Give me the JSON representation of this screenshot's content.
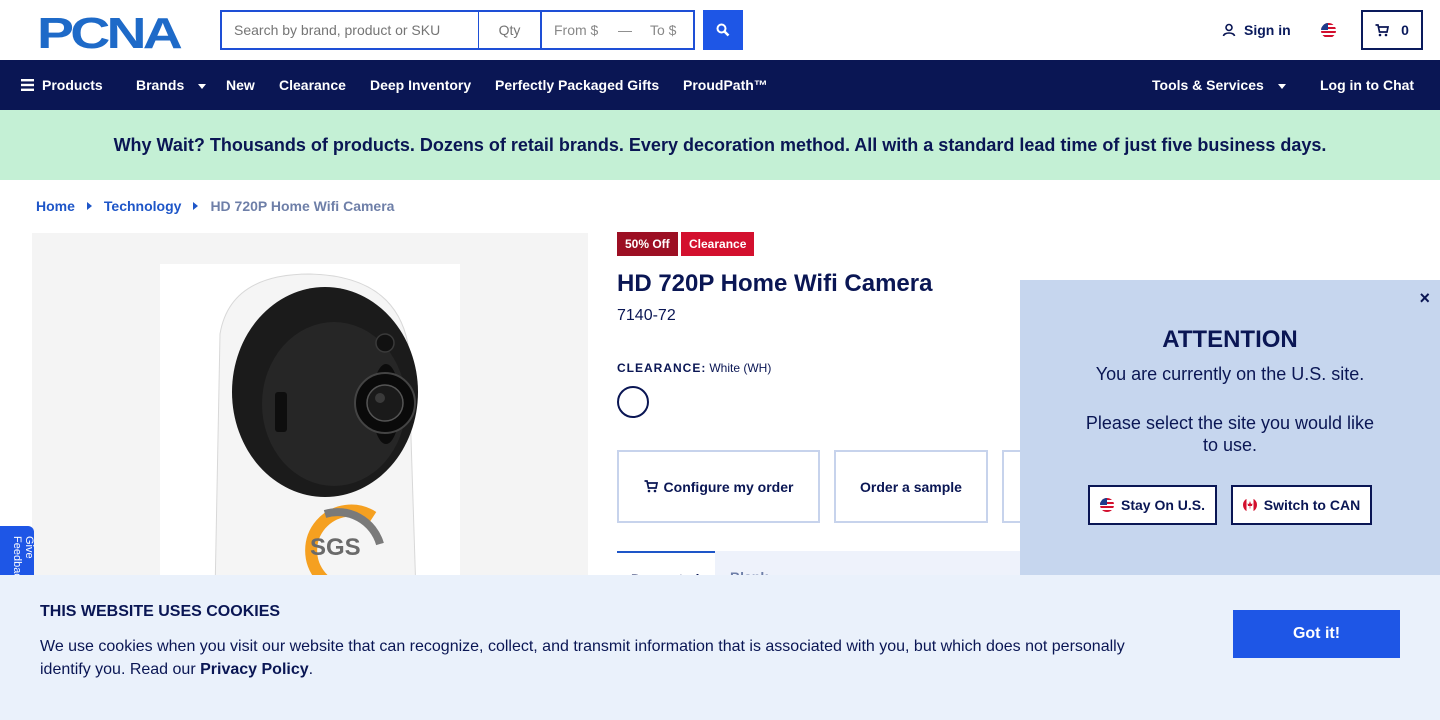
{
  "header": {
    "logo_text": "PCNA",
    "search_placeholder": "Search by brand, product or SKU",
    "qty_placeholder": "Qty",
    "price_from_placeholder": "From $",
    "price_to_placeholder": "To $",
    "sign_in_label": "Sign in",
    "cart_count": "0"
  },
  "nav": {
    "items": [
      "Products",
      "Brands",
      "New",
      "Clearance",
      "Deep Inventory",
      "Perfectly Packaged Gifts",
      "ProudPath™"
    ],
    "right_items": [
      "Tools & Services",
      "Log in to Chat"
    ]
  },
  "promo": {
    "text": "Why Wait? Thousands of products. Dozens of retail brands. Every decoration method. All with a standard lead time of just five business days."
  },
  "breadcrumb": [
    "Home",
    "Technology",
    "HD 720P Home Wifi Camera"
  ],
  "product": {
    "badges": [
      "50% Off",
      "Clearance"
    ],
    "title": "HD 720P Home Wifi Camera",
    "sku": "7140-72",
    "color_label": "CLEARANCE:",
    "color_value": "White (WH)",
    "actions": [
      "Configure my order",
      "Order a sample"
    ],
    "tabs": [
      "Decorated",
      "Blank"
    ],
    "image_text": "SGS"
  },
  "feedback_label": "Give Feedback",
  "modal": {
    "title": "ATTENTION",
    "line1": "You are currently on the U.S. site.",
    "line2": "Please select the site you would like to use.",
    "stay_label": "Stay On U.S.",
    "switch_label": "Switch to CAN",
    "close_symbol": "×"
  },
  "cookie": {
    "title": "THIS WEBSITE USES COOKIES",
    "text": "We use cookies when you visit our website that can recognize, collect, and transmit information that is associated with you, but which does not personally identify you. Read our",
    "link": "Privacy Policy",
    "end": ".",
    "button": "Got it!"
  },
  "colors": {
    "navy": "#0a1654",
    "accent_blue": "#1e56e6",
    "promo_green": "#c4f0d5",
    "badge_dark_red": "#9c0f23",
    "badge_red": "#d3102e",
    "modal_bg": "#c6d6ee",
    "cookie_bg": "#eaf1fb"
  }
}
